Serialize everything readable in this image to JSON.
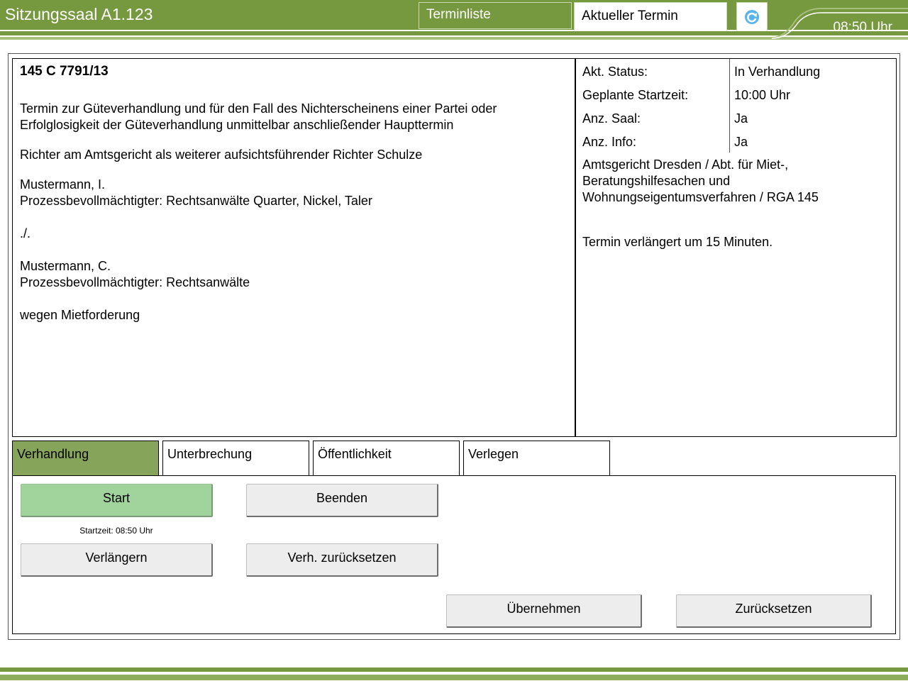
{
  "header": {
    "title": "Sitzungssaal A1.123",
    "tabs": [
      "Terminliste",
      "Aktueller Termin"
    ],
    "time": "08:50 Uhr",
    "refresh_icon": "refresh-icon"
  },
  "case": {
    "number": "145 C 7791/13",
    "description": "Termin zur Güteverhandlung und für den Fall des Nichterscheinens einer Partei oder\nErfolglosigkeit der Güteverhandlung unmittelbar anschließender Haupttermin",
    "judge": "Richter am Amtsgericht als weiterer aufsichtsführender Richter Schulze",
    "party1": "Mustermann, I.\nProzessbevollmächtigter: Rechtsanwälte Quarter, Nickel, Taler",
    "separator": "./.",
    "party2": "Mustermann, C.\nProzessbevollmächtigter: Rechtsanwälte",
    "subject": "wegen Mietforderung"
  },
  "info": {
    "rows": [
      {
        "label": "Akt. Status:",
        "value": "In Verhandlung"
      },
      {
        "label": "Geplante Startzeit:",
        "value": "10:00 Uhr"
      },
      {
        "label": "Anz. Saal:",
        "value": "Ja"
      },
      {
        "label": "Anz. Info:",
        "value": "Ja"
      }
    ],
    "court": "Amtsgericht Dresden / Abt. für Miet-,\nBeratungshilfesachen und\nWohnungseigentumsverfahren / RGA 145",
    "note": "Termin verlängert um 15 Minuten."
  },
  "tabs": [
    "Verhandlung",
    "Unterbrechung",
    "Öffentlichkeit",
    "Verlegen"
  ],
  "active_tab": "Verhandlung",
  "buttons": {
    "start": "Start",
    "end": "Beenden",
    "extend": "Verlängern",
    "reset_hearing": "Verh. zurücksetzen",
    "apply": "Übernehmen",
    "reset": "Zurücksetzen"
  },
  "start_time_text": "Startzeit: 08:50 Uhr",
  "colors": {
    "brand_green": "#76983f",
    "active_tab": "#87a55a",
    "start_button": "#a1d39c",
    "button": "#ededed"
  }
}
